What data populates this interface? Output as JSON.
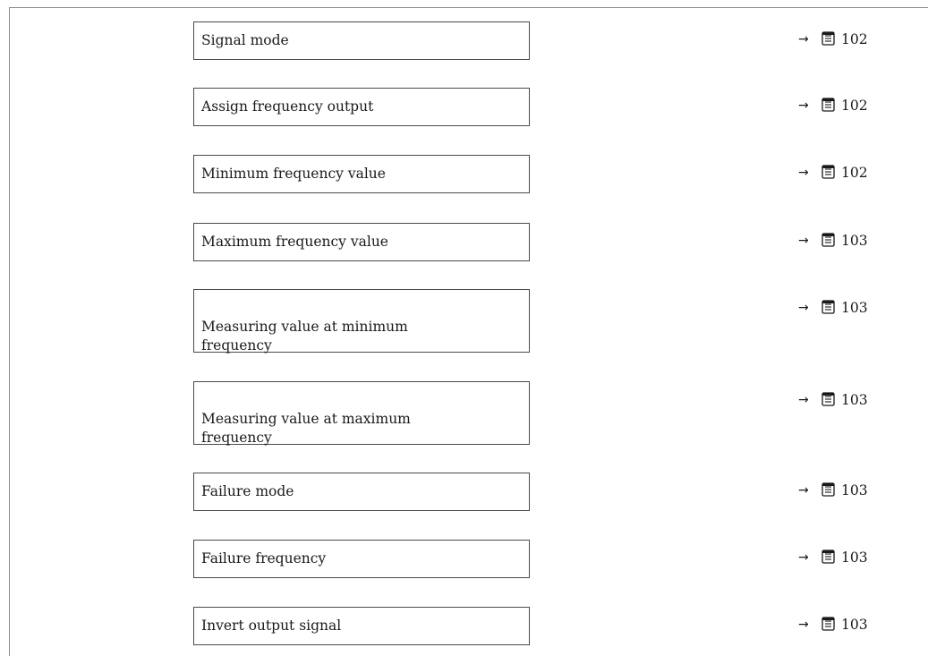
{
  "params": [
    {
      "label": "Signal mode",
      "arrow": "→",
      "page": "102"
    },
    {
      "label": "Assign frequency output",
      "arrow": "→",
      "page": "102"
    },
    {
      "label": "Minimum frequency value",
      "arrow": "→",
      "page": "102"
    },
    {
      "label": "Maximum frequency value",
      "arrow": "→",
      "page": "103"
    },
    {
      "label": "Measuring value at minimum\nfrequency",
      "arrow": "→",
      "page": "103"
    },
    {
      "label": "Measuring value at maximum\nfrequency",
      "arrow": "→",
      "page": "103"
    },
    {
      "label": "Failure mode",
      "arrow": "→",
      "page": "103"
    },
    {
      "label": "Failure frequency",
      "arrow": "→",
      "page": "103"
    },
    {
      "label": "Invert output signal",
      "arrow": "→",
      "page": "103"
    }
  ],
  "icons": {
    "page_ref": "book-page-icon"
  }
}
